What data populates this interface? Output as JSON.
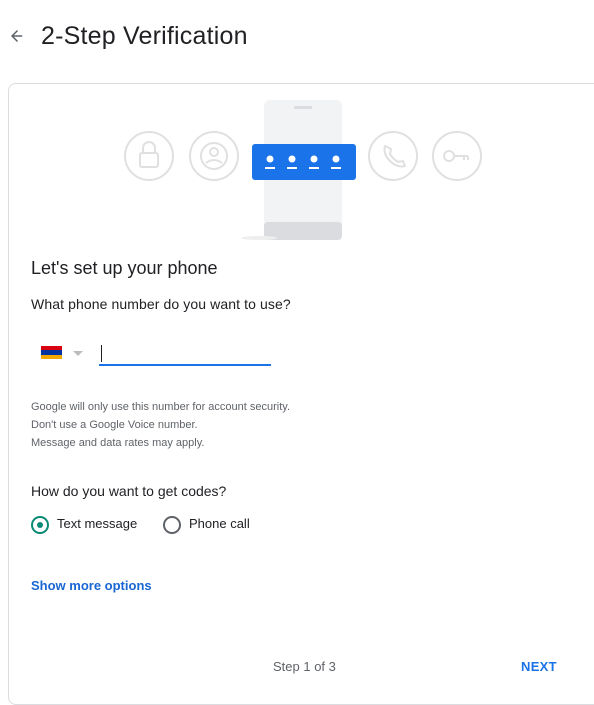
{
  "header": {
    "back_icon": "arrow-back-icon",
    "title": "2-Step Verification"
  },
  "illustration": {
    "icons": [
      "lock-icon",
      "account-icon",
      "phone-icon",
      "key-icon"
    ],
    "accent": "#1a73e8"
  },
  "setup": {
    "title": "Let's set up your phone",
    "phone_question": "What phone number do you want to use?",
    "country_flag": "armenia-flag",
    "phone_value": "",
    "hints": [
      "Google will only use this number for account security.",
      "Don't use a Google Voice number.",
      "Message and data rates may apply."
    ],
    "codes_question": "How do you want to get codes?",
    "options": [
      {
        "label": "Text message",
        "selected": true
      },
      {
        "label": "Phone call",
        "selected": false
      }
    ],
    "more_options": "Show more options"
  },
  "footer": {
    "step": "Step 1 of 3",
    "next": "NEXT"
  },
  "colors": {
    "accent_blue": "#1a73e8",
    "radio_selected": "#0a8a74",
    "border": "#dadce0"
  }
}
